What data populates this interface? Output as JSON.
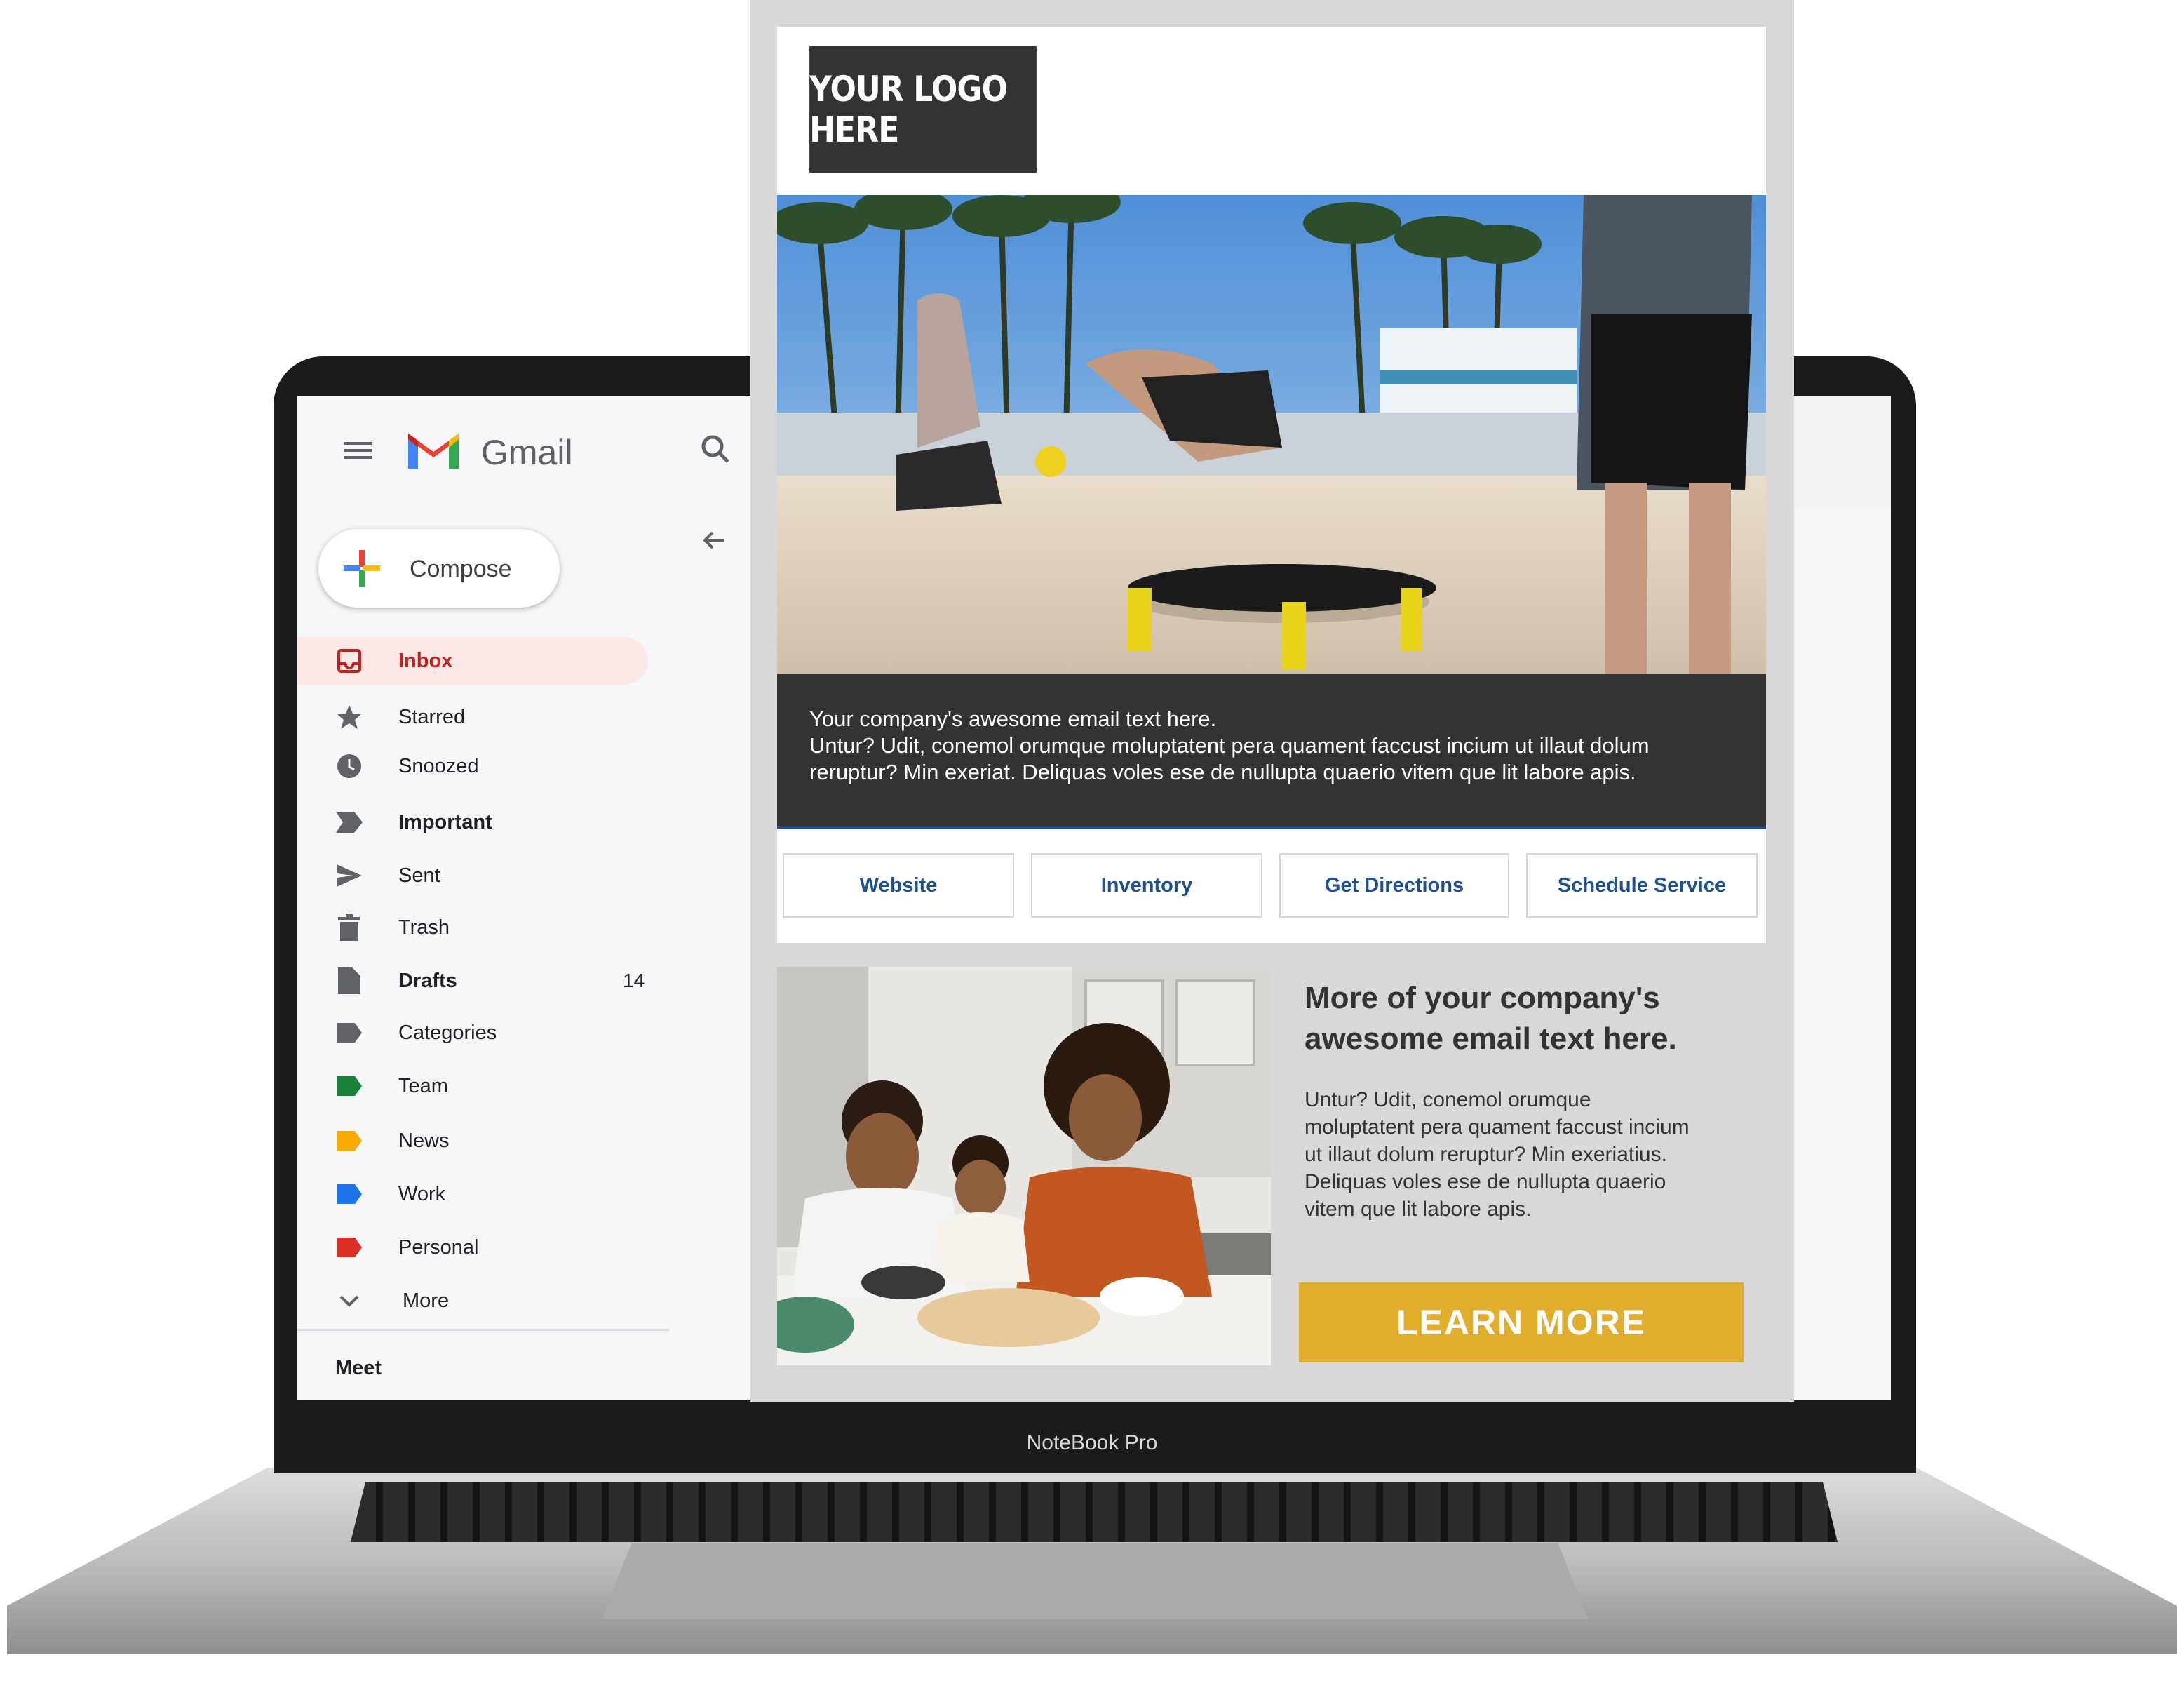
{
  "laptop": {
    "brand": "NoteBook Pro"
  },
  "gmail": {
    "app_name": "Gmail",
    "compose_label": "Compose",
    "nav": [
      {
        "label": "Inbox",
        "icon": "inbox-icon",
        "active": true,
        "bold": true
      },
      {
        "label": "Starred",
        "icon": "star-icon"
      },
      {
        "label": "Snoozed",
        "icon": "clock-icon"
      },
      {
        "label": "Important",
        "icon": "important-icon",
        "bold": true
      },
      {
        "label": "Sent",
        "icon": "send-icon"
      },
      {
        "label": "Trash",
        "icon": "trash-icon"
      },
      {
        "label": "Drafts",
        "icon": "draft-icon",
        "bold": true,
        "count": "14"
      },
      {
        "label": "Categories",
        "icon": "label-icon"
      },
      {
        "label": "Team",
        "icon": "label-icon",
        "color": "#188038"
      },
      {
        "label": "News",
        "icon": "label-icon",
        "color": "#f9ab00"
      },
      {
        "label": "Work",
        "icon": "label-icon",
        "color": "#1a73e8"
      },
      {
        "label": "Personal",
        "icon": "label-icon",
        "color": "#d93025"
      },
      {
        "label": "More",
        "icon": "chevron-down-icon"
      }
    ],
    "meet_label": "Meet",
    "colors": {
      "active_bg": "#fce8e6",
      "active_text": "#c5221f"
    }
  },
  "email": {
    "logo_text": "YOUR LOGO HERE",
    "band_title": "Your company's awesome email text here.",
    "band_line1": "Untur? Udit, conemol orumque moluptatent pera quament faccust incium ut illaut dolum",
    "band_line2": "reruptur? Min exeriat. Deliquas voles ese de nullupta quaerio vitem que lit labore apis.",
    "buttons": [
      "Website",
      "Inventory",
      "Get Directions",
      "Schedule Service"
    ],
    "feature_heading_line1": "More of your company's",
    "feature_heading_line2": "awesome email text here.",
    "feature_body_lines": [
      "Untur? Udit, conemol orumque",
      "moluptatent pera quament faccust incium",
      "ut illaut dolum reruptur? Min exeriatius.",
      "Deliquas voles ese de nullupta quaerio",
      "vitem que lit labore apis."
    ],
    "cta_label": "LEARN  MORE",
    "colors": {
      "band": "#323335",
      "link": "#1d4f91",
      "cta": "#e0ae2c"
    }
  }
}
